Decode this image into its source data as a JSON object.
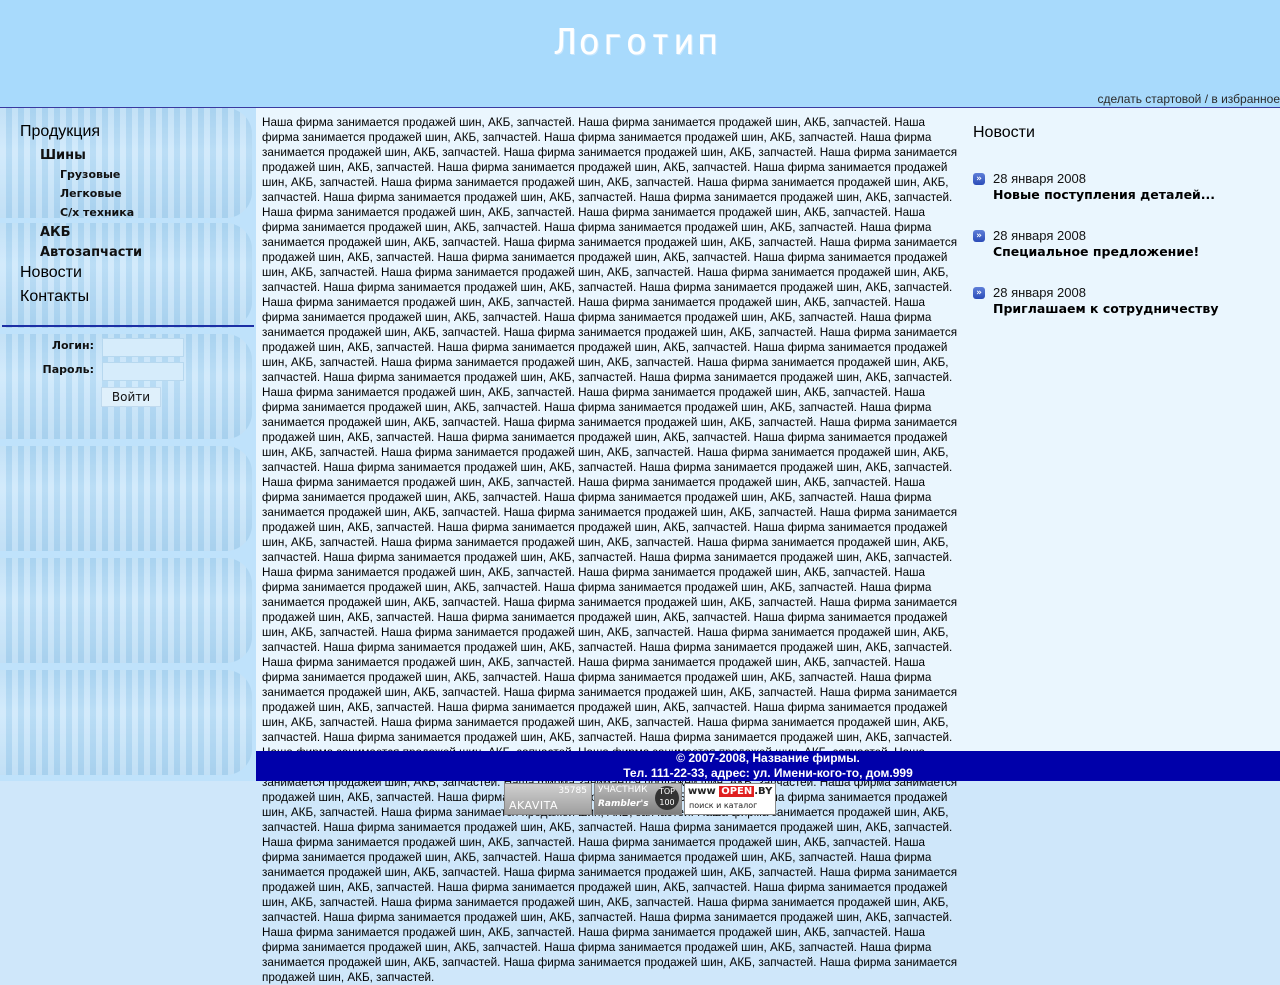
{
  "header": {
    "logo": "Логотип",
    "links": "сделать стартовой / в избранное"
  },
  "sidebar": {
    "menu": {
      "products": "Продукция",
      "tires": "Шины",
      "trucks": "Грузовые",
      "cars": "Легковые",
      "agri": "С/х техника",
      "akb": "АКБ",
      "autoparts": "Автозапчасти",
      "news": "Новости",
      "contacts": "Контакты"
    },
    "login": {
      "login_label": "Логин:",
      "password_label": "Пароль:",
      "submit": "Войти"
    }
  },
  "main": {
    "text": "Наша фирма занимается продажей шин, АКБ, запчастей. Наша фирма занимается продажей шин, АКБ, запчастей. Наша фирма занимается продажей шин, АКБ, запчастей. Наша фирма занимается продажей шин, АКБ, запчастей. Наша фирма занимается продажей шин, АКБ, запчастей. Наша фирма занимается продажей шин, АКБ, запчастей. Наша фирма занимается продажей шин, АКБ, запчастей. Наша фирма занимается продажей шин, АКБ, запчастей. Наша фирма занимается продажей шин, АКБ, запчастей. Наша фирма занимается продажей шин, АКБ, запчастей. Наша фирма занимается продажей шин, АКБ, запчастей. Наша фирма занимается продажей шин, АКБ, запчастей. Наша фирма занимается продажей шин, АКБ, запчастей. Наша фирма занимается продажей шин, АКБ, запчастей. Наша фирма занимается продажей шин, АКБ, запчастей. Наша фирма занимается продажей шин, АКБ, запчастей. Наша фирма занимается продажей шин, АКБ, запчастей. Наша фирма занимается продажей шин, АКБ, запчастей. Наша фирма занимается продажей шин, АКБ, запчастей. Наша фирма занимается продажей шин, АКБ, запчастей. Наша фирма занимается продажей шин, АКБ, запчастей. Наша фирма занимается продажей шин, АКБ, запчастей. Наша фирма занимается продажей шин, АКБ, запчастей. Наша фирма занимается продажей шин, АКБ, запчастей. Наша фирма занимается продажей шин, АКБ, запчастей. Наша фирма занимается продажей шин, АКБ, запчастей. Наша фирма занимается продажей шин, АКБ, запчастей. Наша фирма занимается продажей шин, АКБ, запчастей. Наша фирма занимается продажей шин, АКБ, запчастей. Наша фирма занимается продажей шин, АКБ, запчастей. Наша фирма занимается продажей шин, АКБ, запчастей. Наша фирма занимается продажей шин, АКБ, запчастей. Наша фирма занимается продажей шин, АКБ, запчастей. Наша фирма занимается продажей шин, АКБ, запчастей. Наша фирма занимается продажей шин, АКБ, запчастей. Наша фирма занимается продажей шин, АКБ, запчастей. Наша фирма занимается продажей шин, АКБ, запчастей. Наша фирма занимается продажей шин, АКБ, запчастей. Наша фирма занимается продажей шин, АКБ, запчастей. Наша фирма занимается продажей шин, АКБ, запчастей. Наша фирма занимается продажей шин, АКБ, запчастей. Наша фирма занимается продажей шин, АКБ, запчастей. Наша фирма занимается продажей шин, АКБ, запчастей. Наша фирма занимается продажей шин, АКБ, запчастей. Наша фирма занимается продажей шин, АКБ, запчастей. Наша фирма занимается продажей шин, АКБ, запчастей. Наша фирма занимается продажей шин, АКБ, запчастей. Наша фирма занимается продажей шин, АКБ, запчастей. Наша фирма занимается продажей шин, АКБ, запчастей. Наша фирма занимается продажей шин, АКБ, запчастей. Наша фирма занимается продажей шин, АКБ, запчастей. Наша фирма занимается продажей шин, АКБ, запчастей. Наша фирма занимается продажей шин, АКБ, запчастей. Наша фирма занимается продажей шин, АКБ, запчастей. Наша фирма занимается продажей шин, АКБ, запчастей. Наша фирма занимается продажей шин, АКБ, запчастей. Наша фирма занимается продажей шин, АКБ, запчастей. Наша фирма занимается продажей шин, АКБ, запчастей. Наша фирма занимается продажей шин, АКБ, запчастей. Наша фирма занимается продажей шин, АКБ, запчастей. Наша фирма занимается продажей шин, АКБ, запчастей. Наша фирма занимается продажей шин, АКБ, запчастей. Наша фирма занимается продажей шин, АКБ, запчастей. Наша фирма занимается продажей шин, АКБ, запчастей. Наша фирма занимается продажей шин, АКБ, запчастей. Наша фирма занимается продажей шин, АКБ, запчастей. Наша фирма занимается продажей шин, АКБ, запчастей. Наша фирма занимается продажей шин, АКБ, запчастей. Наша фирма занимается продажей шин, АКБ, запчастей. Наша фирма занимается продажей шин, АКБ, запчастей. Наша фирма занимается продажей шин, АКБ, запчастей. Наша фирма занимается продажей шин, АКБ, запчастей. Наша фирма занимается продажей шин, АКБ, запчастей. Наша фирма занимается продажей шин, АКБ, запчастей. Наша фирма занимается продажей шин, АКБ, запчастей. Наша фирма занимается продажей шин, АКБ, запчастей. Наша фирма занимается продажей шин, АКБ, запчастей. Наша фирма занимается продажей шин, АКБ, запчастей. Наша фирма занимается продажей шин, АКБ, запчастей. Наша фирма занимается продажей шин, АКБ, запчастей. Наша фирма занимается продажей шин, АКБ, запчастей. Наша фирма занимается продажей шин, АКБ, запчастей. Наша фирма занимается продажей шин, АКБ, запчастей. Наша фирма занимается продажей шин, АКБ, запчастей. Наша фирма занимается продажей шин, АКБ, запчастей. Наша фирма занимается продажей шин, АКБ, запчастей. Наша фирма занимается продажей шин, АКБ, запчастей. Наша фирма занимается продажей шин, АКБ, запчастей. Наша фирма занимается продажей шин, АКБ, запчастей. Наша фирма занимается продажей шин, АКБ, запчастей. Наша фирма занимается продажей шин, АКБ, запчастей. Наша фирма занимается продажей шин, АКБ, запчастей. Наша фирма занимается продажей шин, АКБ, запчастей. Наша фирма занимается продажей шин, АКБ, запчастей. Наша фирма занимается продажей шин, АКБ, запчастей. Наша фирма занимается продажей шин, АКБ, запчастей. Наша фирма занимается продажей шин, АКБ, запчастей. Наша фирма занимается продажей шин, АКБ, запчастей. Наша фирма занимается продажей шин, АКБ, запчастей. Наша фирма занимается продажей шин, АКБ, запчастей. Наша фирма занимается продажей шин, АКБ, запчастей. Наша фирма занимается продажей шин, АКБ, запчастей. Наша фирма занимается продажей шин, АКБ, запчастей. Наша фирма занимается продажей шин, АКБ, запчастей. Наша фирма занимается продажей шин, АКБ, запчастей. Наша фирма занимается продажей шин, АКБ, запчастей. Наша фирма занимается продажей шин, АКБ, запчастей. Наша фирма занимается продажей шин, АКБ, запчастей. Наша фирма занимается продажей шин, АКБ, запчастей. Наша фирма занимается продажей шин, АКБ, запчастей. Наша фирма занимается продажей шин, АКБ, запчастей. Наша фирма занимается продажей шин, АКБ, запчастей. Наша фирма занимается продажей шин, АКБ, запчастей. Наша фирма занимается продажей шин, АКБ, запчастей. Наша фирма занимается продажей шин, АКБ, запчастей. Наша фирма занимается продажей шин, АКБ, запчастей. Наша фирма занимается продажей шин, АКБ, запчастей. Наша фирма занимается продажей шин, АКБ, запчастей. Наша фирма занимается продажей шин, АКБ, запчастей. Наша фирма занимается продажей шин, АКБ, запчастей. Наша фирма занимается продажей шин, АКБ, запчастей. Наша фирма занимается продажей шин, АКБ, запчастей. Наша фирма занимается продажей шин, АКБ, запчастей. Наша фирма занимается продажей шин, АКБ, запчастей.",
    "news": {
      "title": "Новости",
      "items": [
        {
          "date": "28 января 2008",
          "title": "Новые поступления деталей..."
        },
        {
          "date": "28 января 2008",
          "title": "Специальное предложение!"
        },
        {
          "date": "28 января 2008",
          "title": "Приглашаем к сотрудничеству"
        }
      ]
    }
  },
  "footer": {
    "line1": "© 2007-2008, Название фирмы.",
    "line2": "Тел. 111-22-33, адрес: ул. Имени-кого-то, дом.999"
  },
  "counters": {
    "akavita_count": "35785",
    "akavita_name": "AKAVITA",
    "rambler_line1": "УЧАСТНИК",
    "rambler_line2": "Rambler's",
    "rambler_badge": "TOP 100",
    "openby_prefix": "www",
    "openby_brand": "OPEN",
    "openby_suffix": ".BY",
    "openby_line2": "поиск и каталог"
  },
  "colors": {
    "header_bg": "#a8dafc",
    "main_bg": "#eaf6fe",
    "footer_bg": "#0000aa",
    "divider": "#1c2fa5"
  }
}
